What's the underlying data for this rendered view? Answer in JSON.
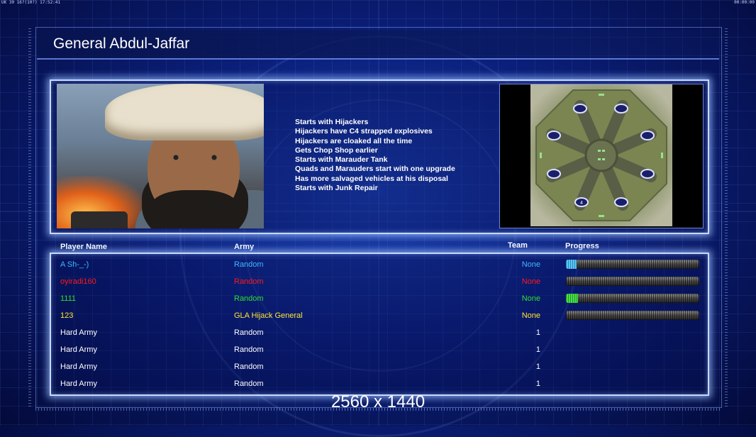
{
  "status_bar": {
    "left": "UK 30 16?(10?) 17:52:41",
    "right": "00:00:00"
  },
  "general": {
    "name": "General Abdul-Jaffar",
    "traits": [
      "Starts with Hijackers",
      "Hijackers have C4 strapped explosives",
      "Hijackers are cloaked all the time",
      "Gets Chop Shop earlier",
      "Starts with Marauder Tank",
      "Quads and Marauders start with one upgrade",
      "Has more salvaged vehicles at his disposal",
      "Starts with Junk Repair"
    ]
  },
  "map_preview": {
    "player_marker": "4"
  },
  "table": {
    "headers": {
      "player": "Player Name",
      "army": "Army",
      "team": "Team",
      "progress": "Progress"
    },
    "rows": [
      {
        "player": "A Sh-_-)",
        "army": "Random",
        "team": "None",
        "color": "#3fb8ff",
        "progress": 0.08,
        "fill": "#55c8ff"
      },
      {
        "player": "oyiradi160",
        "army": "Random",
        "team": "None",
        "color": "#ff1a1a",
        "progress": 0.0,
        "fill": "#ff3030"
      },
      {
        "player": "1111",
        "army": "Random",
        "team": "None",
        "color": "#2ee02e",
        "progress": 0.09,
        "fill": "#44e044"
      },
      {
        "player": "123",
        "army": "GLA Hijack General",
        "team": "None",
        "color": "#ffe62e",
        "progress": 0.0,
        "fill": "#ffe62e"
      },
      {
        "player": "Hard Army",
        "army": "Random",
        "team": "1",
        "color": "#ffffff"
      },
      {
        "player": "Hard Army",
        "army": "Random",
        "team": "1",
        "color": "#ffffff"
      },
      {
        "player": "Hard Army",
        "army": "Random",
        "team": "1",
        "color": "#ffffff"
      },
      {
        "player": "Hard Army",
        "army": "Random",
        "team": "1",
        "color": "#ffffff"
      }
    ]
  },
  "resolution_label": "2560 x 1440"
}
